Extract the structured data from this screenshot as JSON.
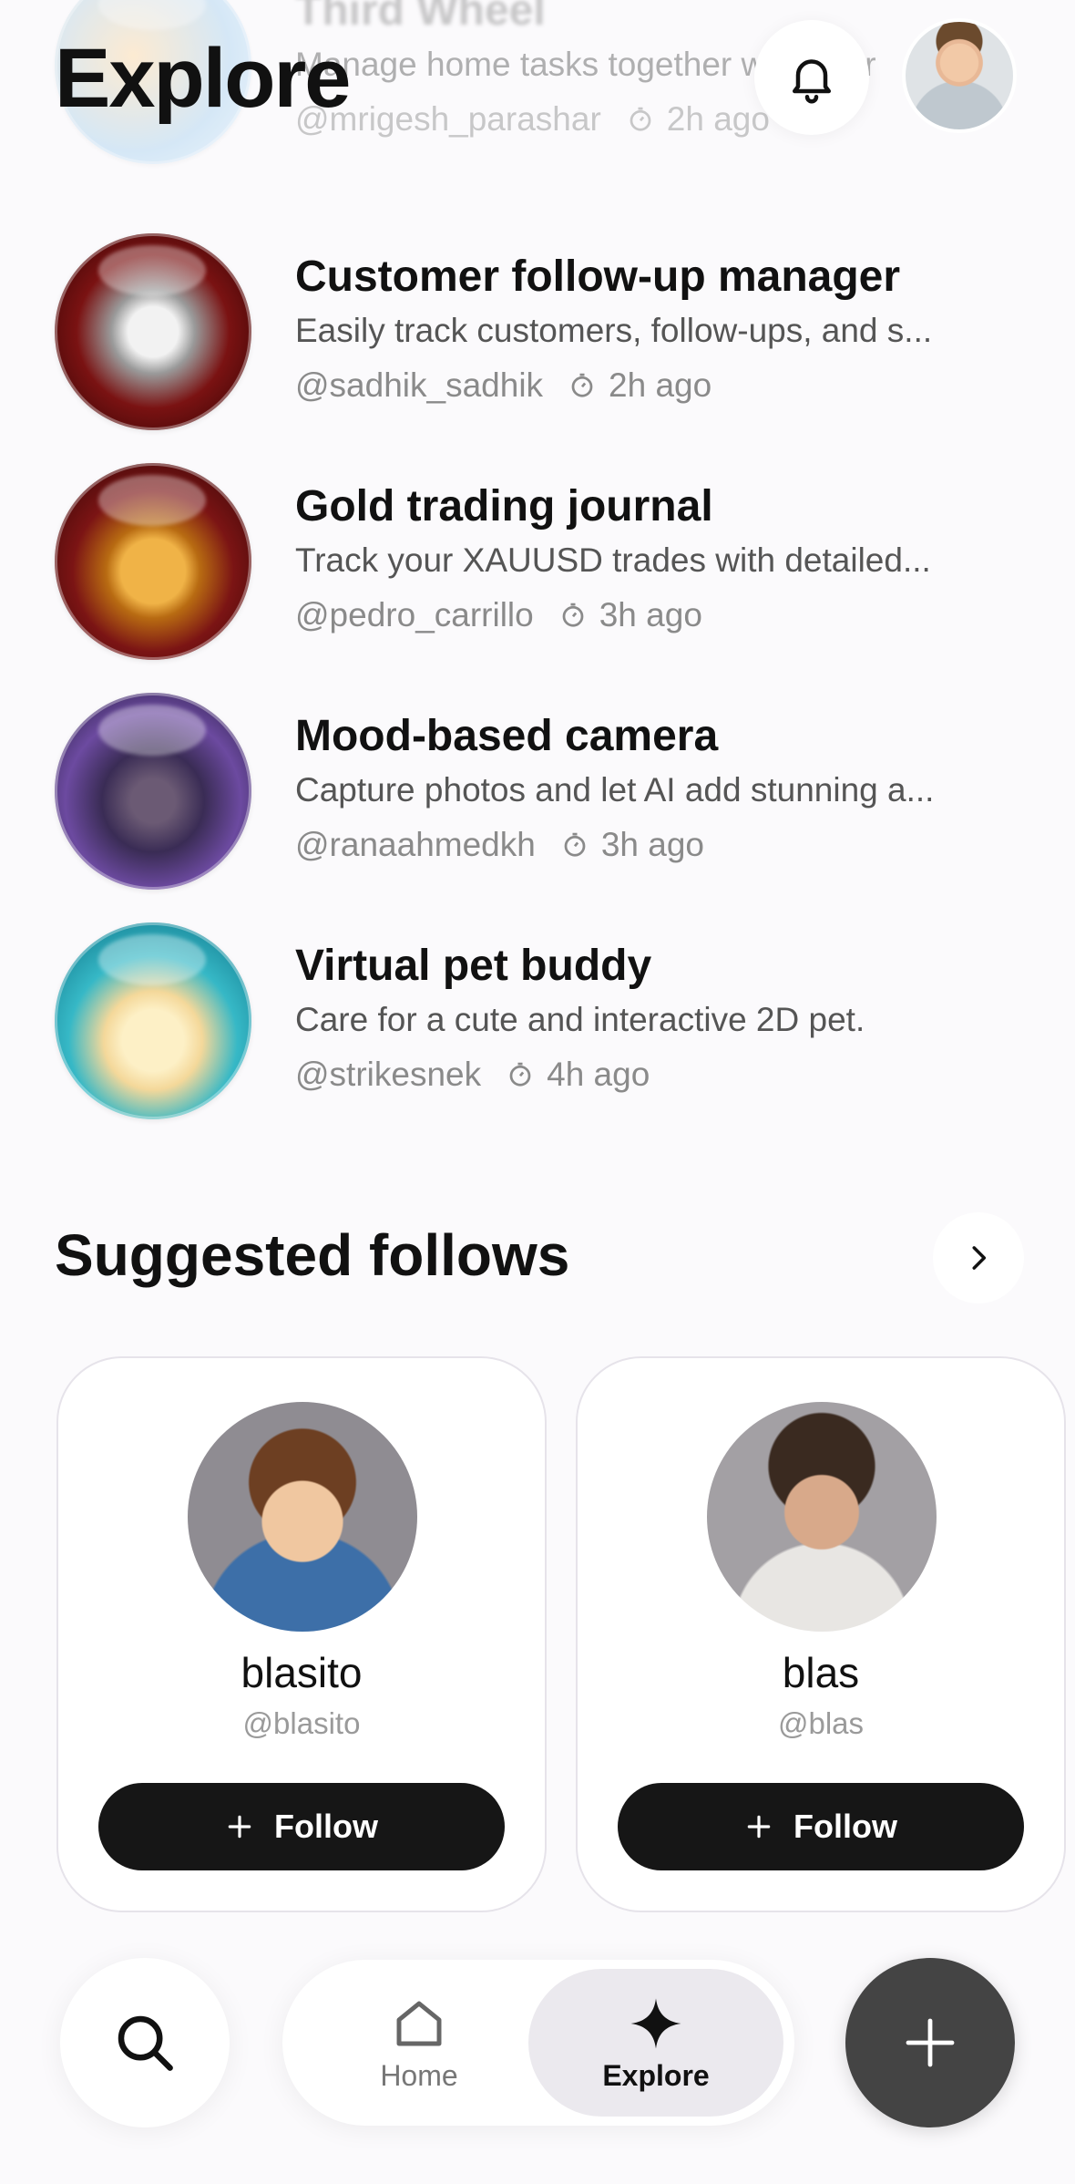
{
  "header": {
    "title": "Explore"
  },
  "projects": [
    {
      "name": "Third Wheel",
      "description": "Manage home tasks together with your",
      "handle": "@mrigesh_parashar",
      "time": "2h ago"
    },
    {
      "name": "Customer follow-up manager",
      "description": "Easily track customers, follow-ups, and s...",
      "handle": "@sadhik_sadhik",
      "time": "2h ago"
    },
    {
      "name": "Gold trading journal",
      "description": "Track your XAUUSD trades with detailed...",
      "handle": "@pedro_carrillo",
      "time": "3h ago"
    },
    {
      "name": "Mood-based camera",
      "description": "Capture photos and let AI add stunning a...",
      "handle": "@ranaahmedkh",
      "time": "3h ago"
    },
    {
      "name": "Virtual pet buddy",
      "description": "Care for a cute and interactive 2D pet.",
      "handle": "@strikesnek",
      "time": "4h ago"
    }
  ],
  "suggested": {
    "title": "Suggested follows",
    "users": [
      {
        "name": "blasito",
        "handle": "@blasito",
        "button": "Follow"
      },
      {
        "name": "blas",
        "handle": "@blas",
        "button": "Follow"
      }
    ]
  },
  "nav": {
    "home_label": "Home",
    "explore_label": "Explore"
  }
}
